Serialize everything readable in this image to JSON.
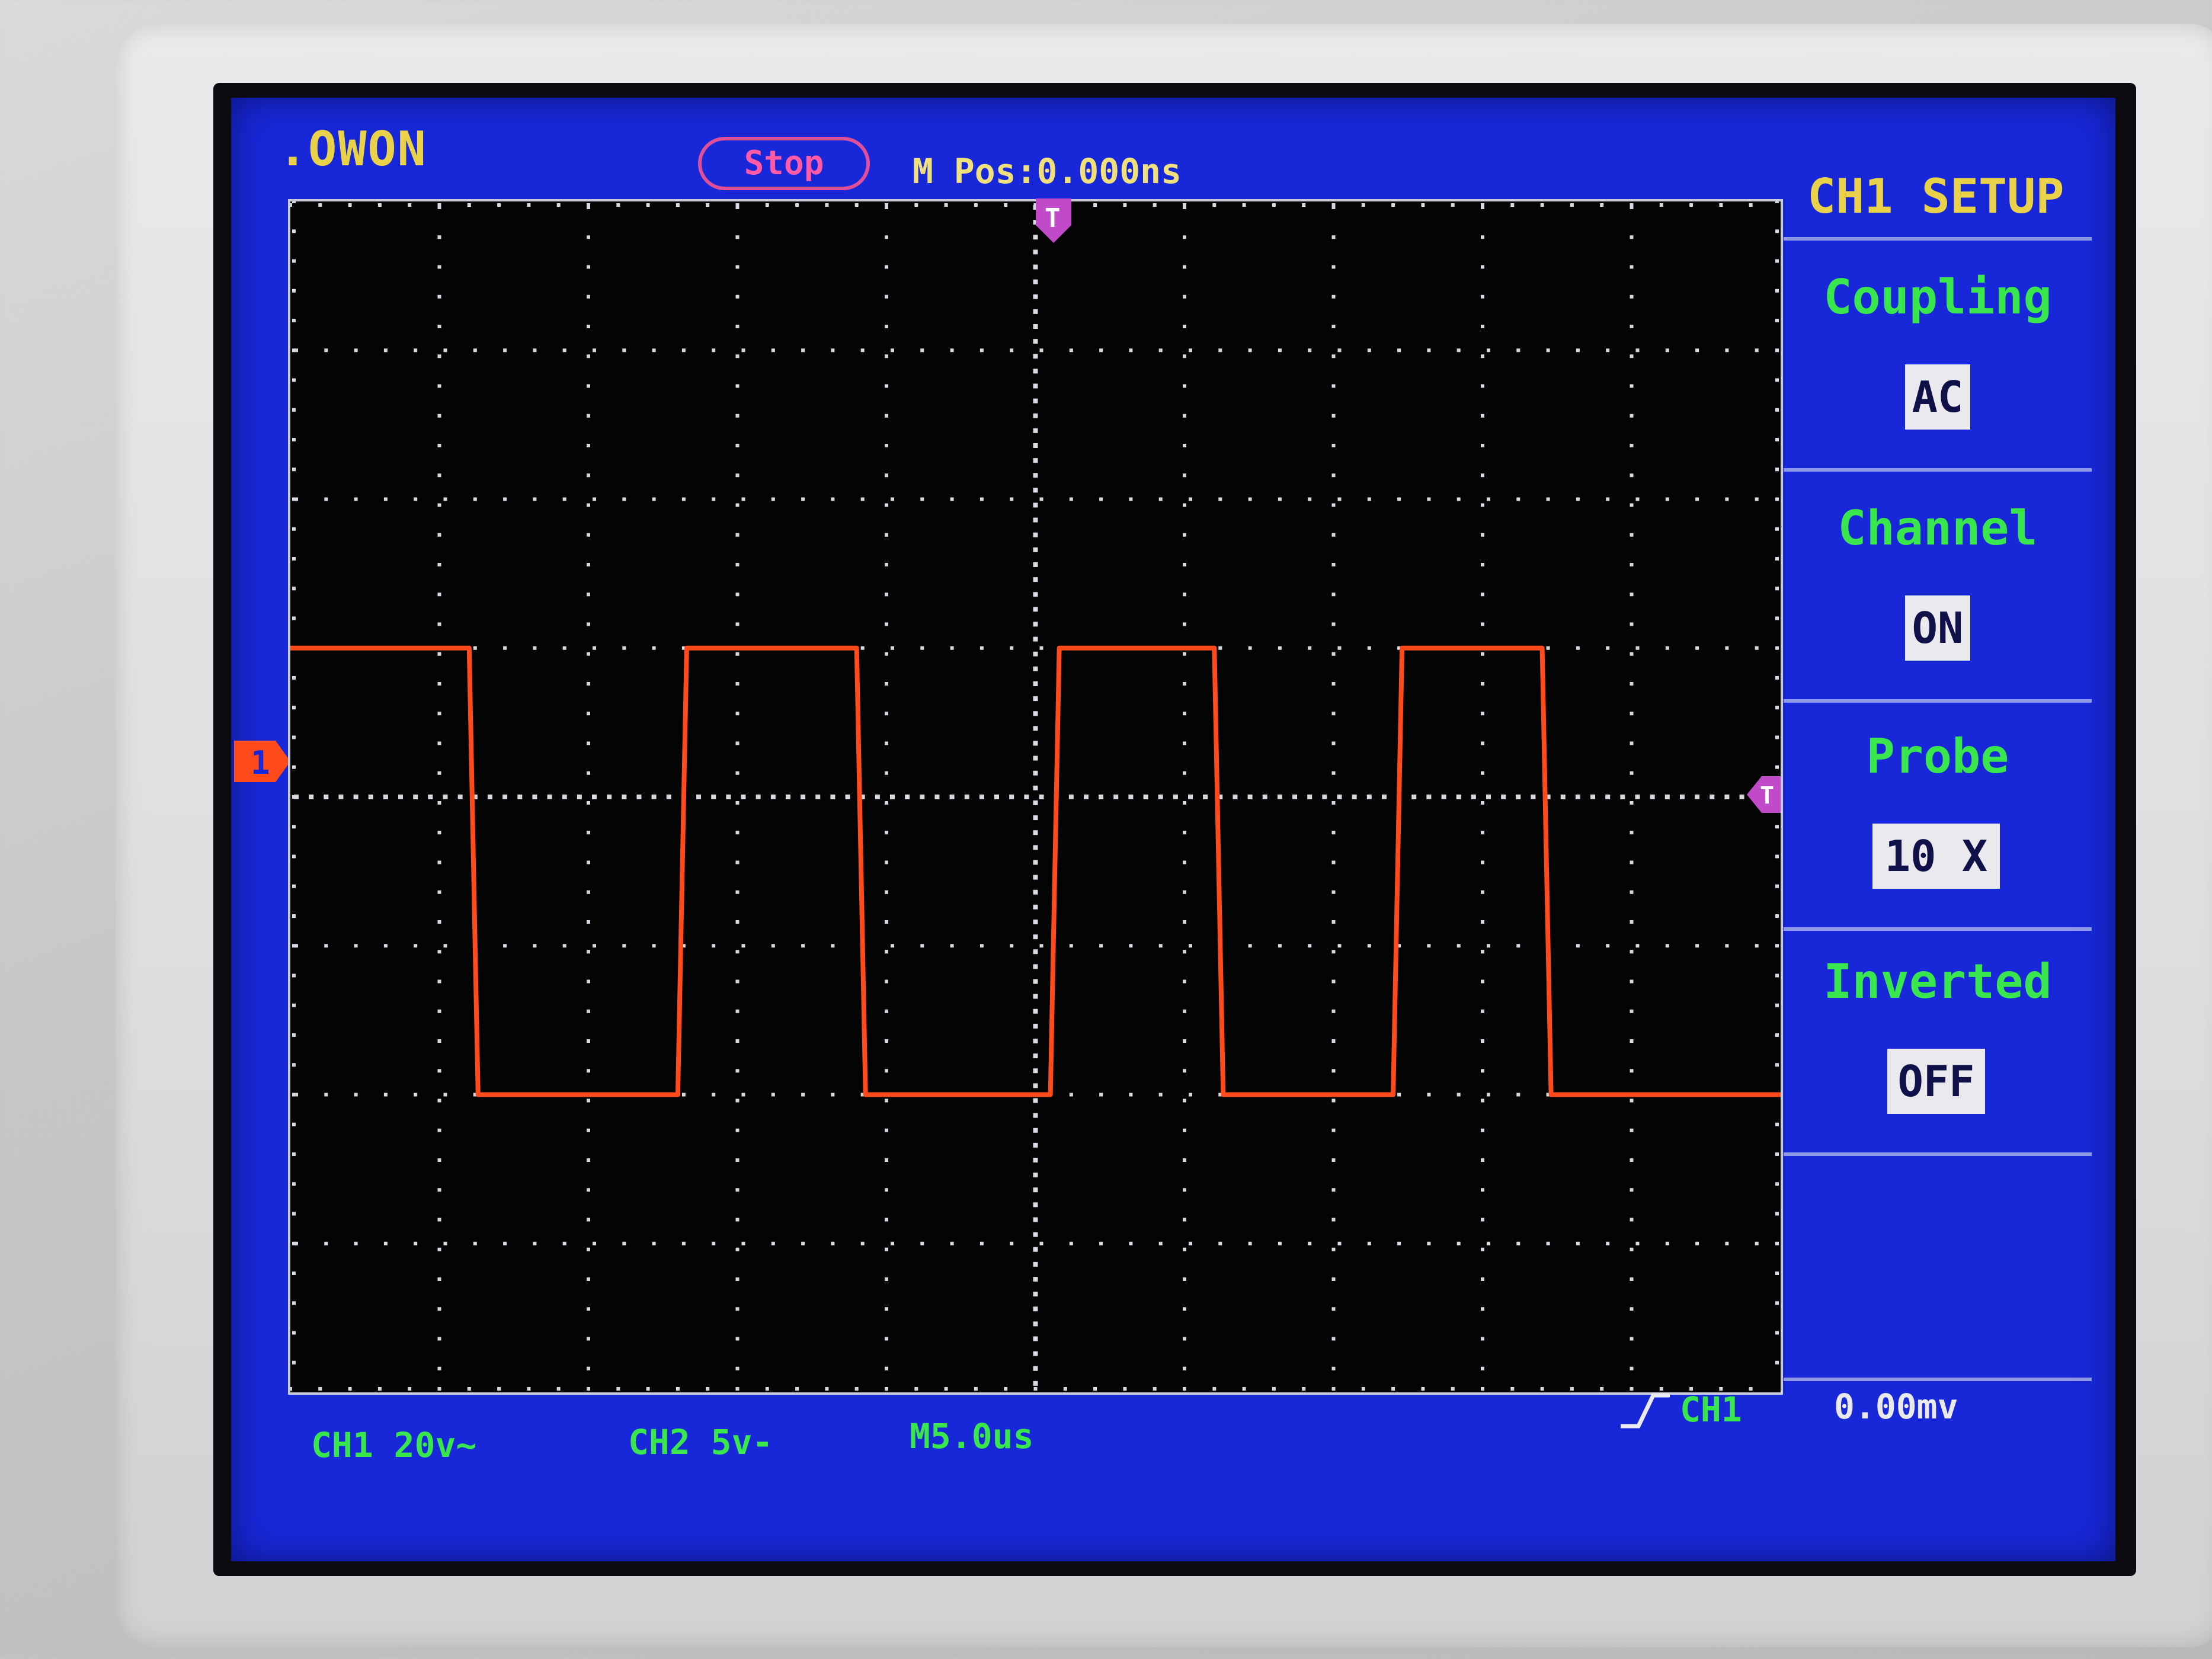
{
  "brand": ".OWON",
  "run_state": "Stop",
  "m_pos": "M Pos:0.000ns",
  "menu": {
    "title": "CH1 SETUP",
    "items": [
      {
        "label": "Coupling",
        "value": "AC"
      },
      {
        "label": "Channel",
        "value": "ON"
      },
      {
        "label": "Probe",
        "value": "10 X"
      },
      {
        "label": "Inverted",
        "value": "OFF"
      }
    ]
  },
  "status": {
    "ch1": "CH1 20v~",
    "ch2": "CH2 5v-",
    "timebase": "M5.0us",
    "trigger_source": "CH1",
    "trigger_level": "0.00mv"
  },
  "markers": {
    "channel": "1",
    "trigger_time": "T",
    "trigger_level": "T"
  },
  "colors": {
    "screen_bg": "#1828d8",
    "trace": "#ff4a1c",
    "label_green": "#39e64d",
    "label_yellow": "#e9d24a",
    "marker_magenta": "#c04ac8"
  },
  "waveform": {
    "type": "square",
    "high_div": 1.0,
    "low_div": -2.0,
    "transitions_div": [
      1.2,
      2.6,
      3.8,
      5.1,
      6.2,
      7.4,
      8.4
    ]
  }
}
